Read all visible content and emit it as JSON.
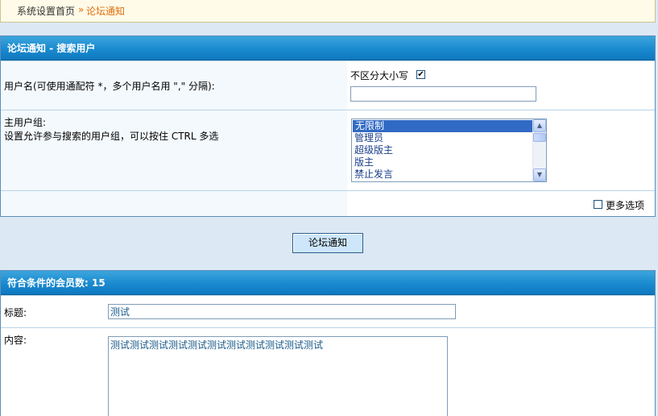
{
  "breadcrumb": {
    "home": "系统设置首页",
    "separator": "»",
    "current": "论坛通知"
  },
  "search_panel": {
    "title": "论坛通知 - 搜索用户",
    "username": {
      "label": "用户名(可使用通配符 *，多个用户名用 \",\" 分隔):",
      "case_insensitive_label": "不区分大小写",
      "case_insensitive_checked": true,
      "value": ""
    },
    "group": {
      "label": "主用户组:",
      "hint": "设置允许参与搜索的用户组，可以按住 CTRL 多选",
      "options": [
        "无限制",
        "管理员",
        "超级版主",
        "版主",
        "禁止发言"
      ],
      "selected": "无限制"
    },
    "more_options": {
      "label": "更多选项",
      "checked": false
    }
  },
  "submit_button": "论坛通知",
  "result_panel": {
    "title": "符合条件的会员数: 15",
    "subject": {
      "label": "标题:",
      "value": "测试"
    },
    "content": {
      "label": "内容:",
      "value": "测试测试测试测试测试测试测试测试测试测试测试"
    }
  }
}
